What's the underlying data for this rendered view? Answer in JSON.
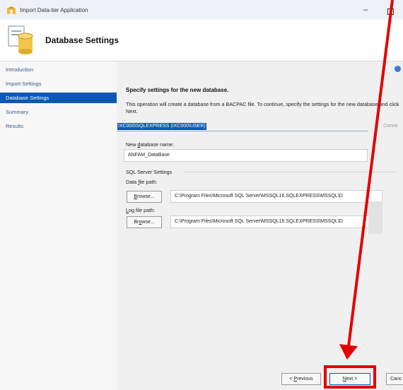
{
  "window": {
    "title": "Import Data-tier Application",
    "minimize": "–"
  },
  "header": {
    "title": "Database Settings"
  },
  "sidebar": {
    "items": [
      {
        "label": "Introduction"
      },
      {
        "label": "Import Settings"
      },
      {
        "label": "Database Settings"
      },
      {
        "label": "Summary"
      },
      {
        "label": "Results"
      }
    ],
    "active_index": 2
  },
  "main": {
    "heading": "Specify settings for the new database.",
    "description": "This operation will create a database from a BACPAC file. To continue, specify the settings for the new database and click Next.",
    "server_connection": "IXC000\\SQLEXPRESS (IXC000\\USER)",
    "connect_label": "Conne",
    "db_name_label": "New database name:",
    "db_name_value": "ANFAM_DataBase",
    "sql_group_label": "SQL Server Settings",
    "data_path_label": "Data file path:",
    "data_path_value": "C:\\Program Files\\Microsoft SQL Server\\MSSQL16.SQLEXPRESS\\MSSQL\\D",
    "log_path_label": "Log file path:",
    "log_path_value": "C:\\Program Files\\Microsoft SQL Server\\MSSQL16.SQLEXPRESS\\MSSQL\\D",
    "browse_label": "Browse..."
  },
  "footer": {
    "previous": "< Previous",
    "next": "Next >",
    "cancel": "Canc"
  },
  "colors": {
    "accent": "#0c58b3",
    "annotation": "#e40000"
  }
}
